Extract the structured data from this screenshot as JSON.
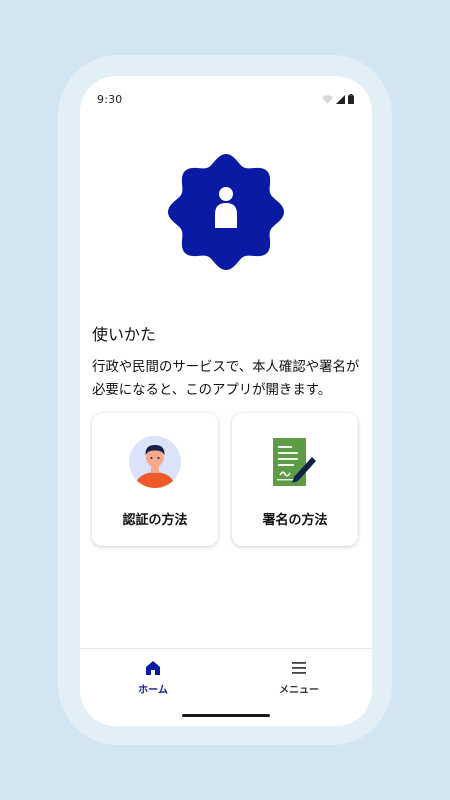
{
  "status_bar": {
    "time": "9:30",
    "icons": [
      "wifi-icon",
      "signal-icon",
      "battery-icon"
    ]
  },
  "hero": {
    "icon": "verified-person-badge-icon",
    "color": "#0b1aa3"
  },
  "main": {
    "heading": "使いかた",
    "description": "行政や民間のサービスで、本人確認や署名が必要になると、このアプリが開きます。"
  },
  "cards": [
    {
      "label": "認証の方法",
      "icon": "person-avatar-illustration"
    },
    {
      "label": "署名の方法",
      "icon": "document-sign-illustration"
    }
  ],
  "bottom_nav": {
    "items": [
      {
        "label": "ホーム",
        "icon": "home-icon",
        "active": true
      },
      {
        "label": "メニュー",
        "icon": "hamburger-menu-icon",
        "active": false
      }
    ]
  },
  "colors": {
    "accent": "#0b1aa3",
    "background": "#d3e5f0",
    "bezel": "#e3eff6"
  }
}
